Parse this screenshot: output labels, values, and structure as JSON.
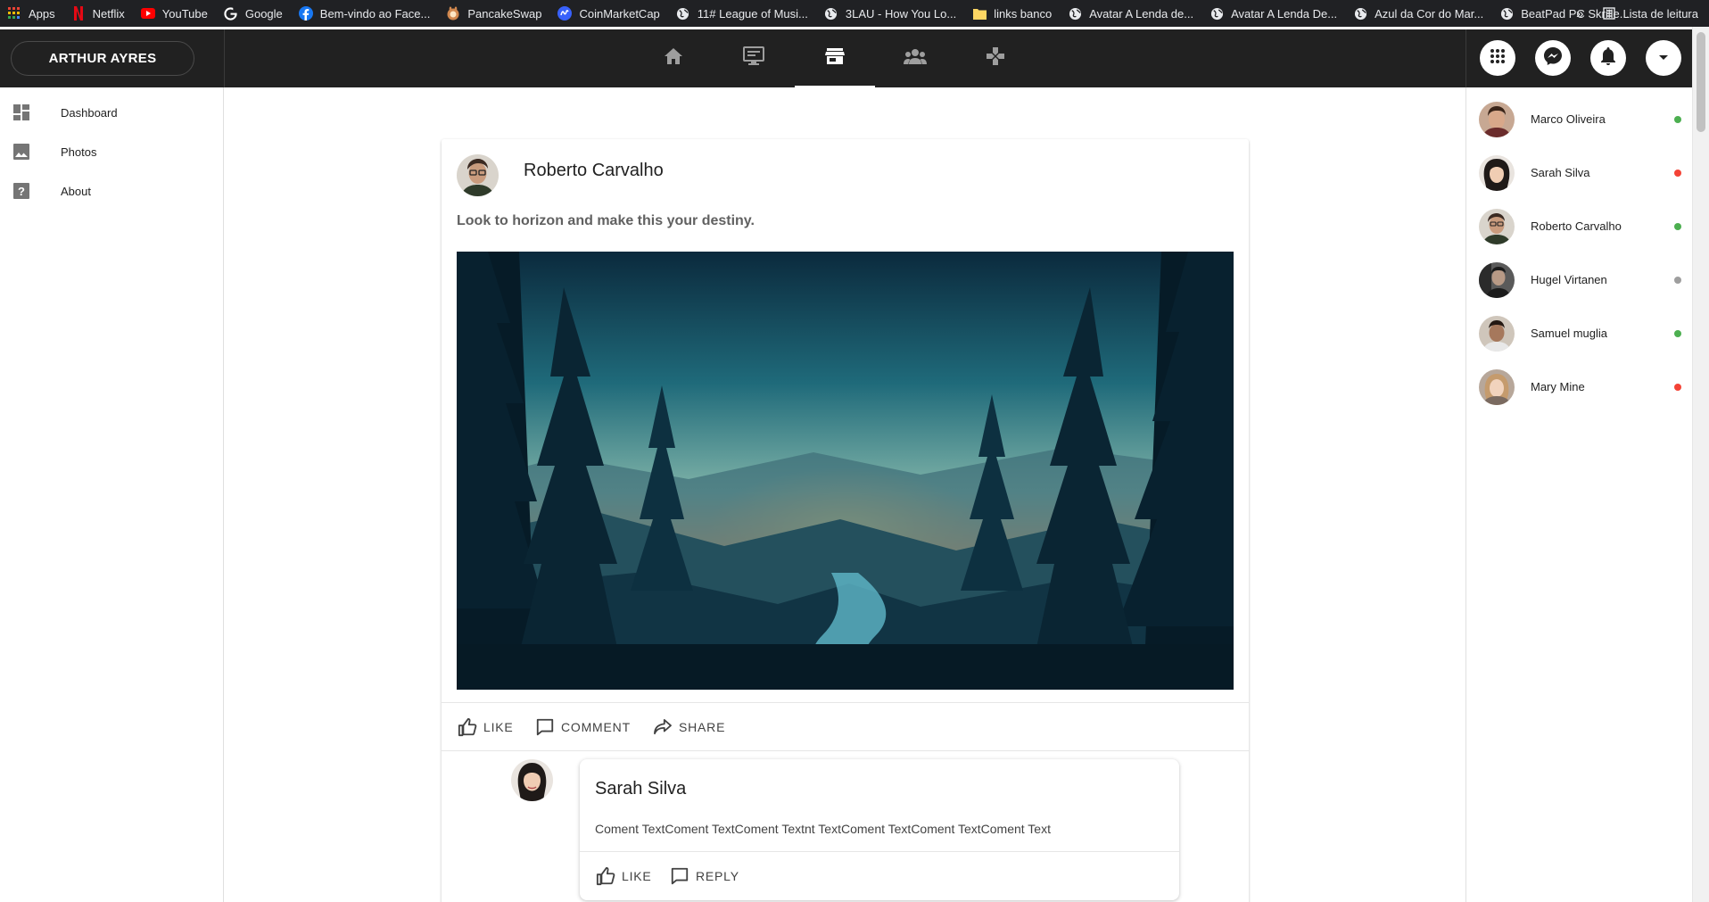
{
  "bookmarks": [
    {
      "label": "Apps",
      "icon": "apps-grid-icon",
      "color": "#ea4335"
    },
    {
      "label": "Netflix",
      "icon": "netflix-icon",
      "color": "#e50914"
    },
    {
      "label": "YouTube",
      "icon": "youtube-icon",
      "color": "#ff0000"
    },
    {
      "label": "Google",
      "icon": "google-icon",
      "color": "#ffffff"
    },
    {
      "label": "Bem-vindo ao Face...",
      "icon": "facebook-icon",
      "color": "#1877f2"
    },
    {
      "label": "PancakeSwap",
      "icon": "pancakeswap-icon",
      "color": "#d1884f"
    },
    {
      "label": "CoinMarketCap",
      "icon": "coinmarketcap-icon",
      "color": "#3861fb"
    },
    {
      "label": "11# League of Musi...",
      "icon": "globe-icon",
      "color": "#e8eaed"
    },
    {
      "label": "3LAU - How You Lo...",
      "icon": "globe-icon",
      "color": "#e8eaed"
    },
    {
      "label": "links banco",
      "icon": "folder-icon",
      "color": "#fdd663"
    },
    {
      "label": "Avatar  A Lenda de...",
      "icon": "globe-icon",
      "color": "#e8eaed"
    },
    {
      "label": "Avatar A Lenda De...",
      "icon": "globe-icon",
      "color": "#e8eaed"
    },
    {
      "label": "Azul da Cor do Mar...",
      "icon": "globe-icon",
      "color": "#e8eaed"
    },
    {
      "label": "BeatPad PC  Skrille...",
      "icon": "globe-icon",
      "color": "#e8eaed"
    }
  ],
  "bookmarks_overflow": "»",
  "reading_list": "Lista de leitura",
  "header": {
    "user_name": "ARTHUR AYRES",
    "nav_tabs": [
      {
        "name": "home",
        "icon": "home-icon",
        "active": false
      },
      {
        "name": "watch",
        "icon": "monitor-icon",
        "active": false
      },
      {
        "name": "marketplace",
        "icon": "store-icon",
        "active": true
      },
      {
        "name": "groups",
        "icon": "groups-icon",
        "active": false
      },
      {
        "name": "gaming",
        "icon": "gamepad-icon",
        "active": false
      }
    ],
    "actions": [
      "apps-menu-icon",
      "messenger-icon",
      "bell-icon",
      "dropdown-arrow-icon"
    ]
  },
  "sidebar": {
    "items": [
      {
        "label": "Dashboard",
        "icon": "dashboard-icon"
      },
      {
        "label": "Photos",
        "icon": "photo-icon"
      },
      {
        "label": "About",
        "icon": "help-icon"
      }
    ]
  },
  "post": {
    "author": "Roberto Carvalho",
    "caption": "Look to horizon and make this your destiny.",
    "actions": {
      "like": "LIKE",
      "comment": "COMMENT",
      "share": "SHARE"
    }
  },
  "comment": {
    "author": "Sarah Silva",
    "text": "Coment TextComent TextComent Textnt TextComent TextComent TextComent Text",
    "actions": {
      "like": "LIKE",
      "reply": "REPLY"
    }
  },
  "contacts": [
    {
      "name": "Marco Oliveira",
      "status": "online",
      "status_color": "#4caf50"
    },
    {
      "name": "Sarah Silva",
      "status": "busy",
      "status_color": "#f44336"
    },
    {
      "name": "Roberto Carvalho",
      "status": "online",
      "status_color": "#4caf50"
    },
    {
      "name": "Hugel Virtanen",
      "status": "offline",
      "status_color": "#9e9e9e"
    },
    {
      "name": "Samuel muglia",
      "status": "online",
      "status_color": "#4caf50"
    },
    {
      "name": "Mary Mine",
      "status": "busy",
      "status_color": "#f44336"
    }
  ]
}
